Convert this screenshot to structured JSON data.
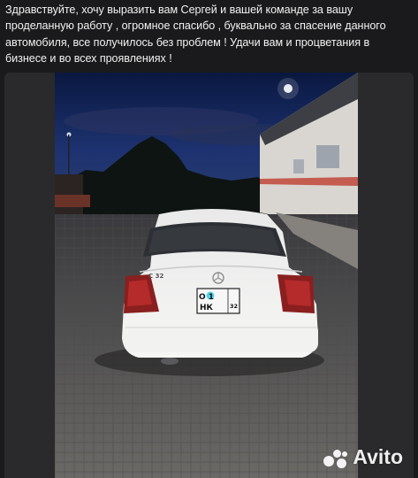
{
  "message": {
    "text": "Здравствуйте, хочу выразить вам Сергей и вашей команде за вашу проделанную работу , огромное спасибо , буквально за спасение данного автомобиля, все получилось без проблем ! Удачи вам и процветания в бизнесе и во всех проявлениях !"
  },
  "photo": {
    "subject": "white Mercedes-Benz C-class sedan at dusk, rear view",
    "car_badge": "C 32",
    "plate_line1": "О   1",
    "plate_line2": "НК",
    "plate_region": "32"
  },
  "watermark": {
    "brand": "Avito",
    "icon": "avito-dots-icon"
  },
  "colors": {
    "background": "#1a1a1c",
    "text": "#f2f2f2",
    "frame": "#2a2a2c"
  }
}
